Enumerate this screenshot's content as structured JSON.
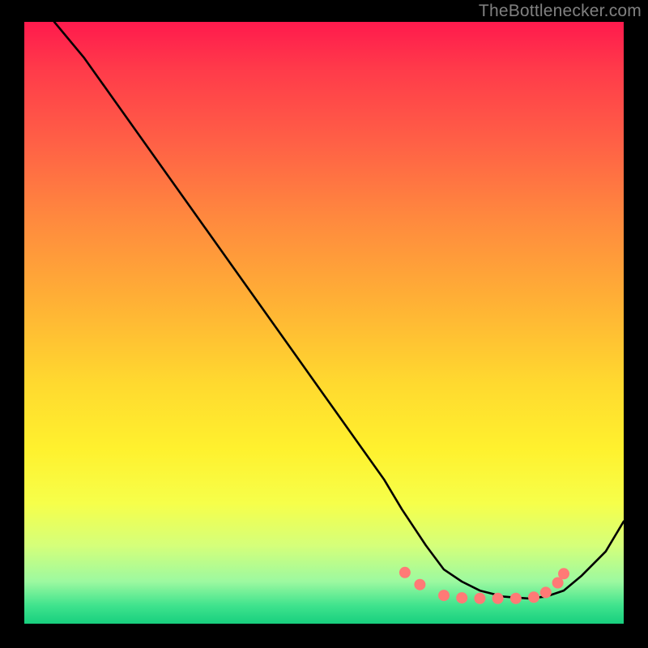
{
  "watermark": "TheBottlenecker.com",
  "chart_data": {
    "type": "line",
    "title": "",
    "xlabel": "",
    "ylabel": "",
    "xlim": [
      0,
      100
    ],
    "ylim": [
      0,
      100
    ],
    "grid": false,
    "series": [
      {
        "name": "curve",
        "x": [
          5,
          10,
          15,
          20,
          25,
          30,
          35,
          40,
          45,
          50,
          55,
          60,
          63,
          67,
          70,
          73,
          76,
          80,
          84,
          87,
          90,
          93,
          97,
          100
        ],
        "y": [
          100,
          94,
          87,
          80,
          73,
          66,
          59,
          52,
          45,
          38,
          31,
          24,
          19,
          13,
          9,
          7,
          5.5,
          4.5,
          4.2,
          4.5,
          5.5,
          8,
          12,
          17
        ]
      }
    ],
    "markers": {
      "name": "dots",
      "color": "#ff7a76",
      "radius": 7,
      "x": [
        63.5,
        66,
        70,
        73,
        76,
        79,
        82,
        85,
        87,
        89,
        90
      ],
      "y": [
        8.5,
        6.5,
        4.7,
        4.3,
        4.2,
        4.2,
        4.2,
        4.4,
        5.2,
        6.8,
        8.3
      ]
    }
  }
}
